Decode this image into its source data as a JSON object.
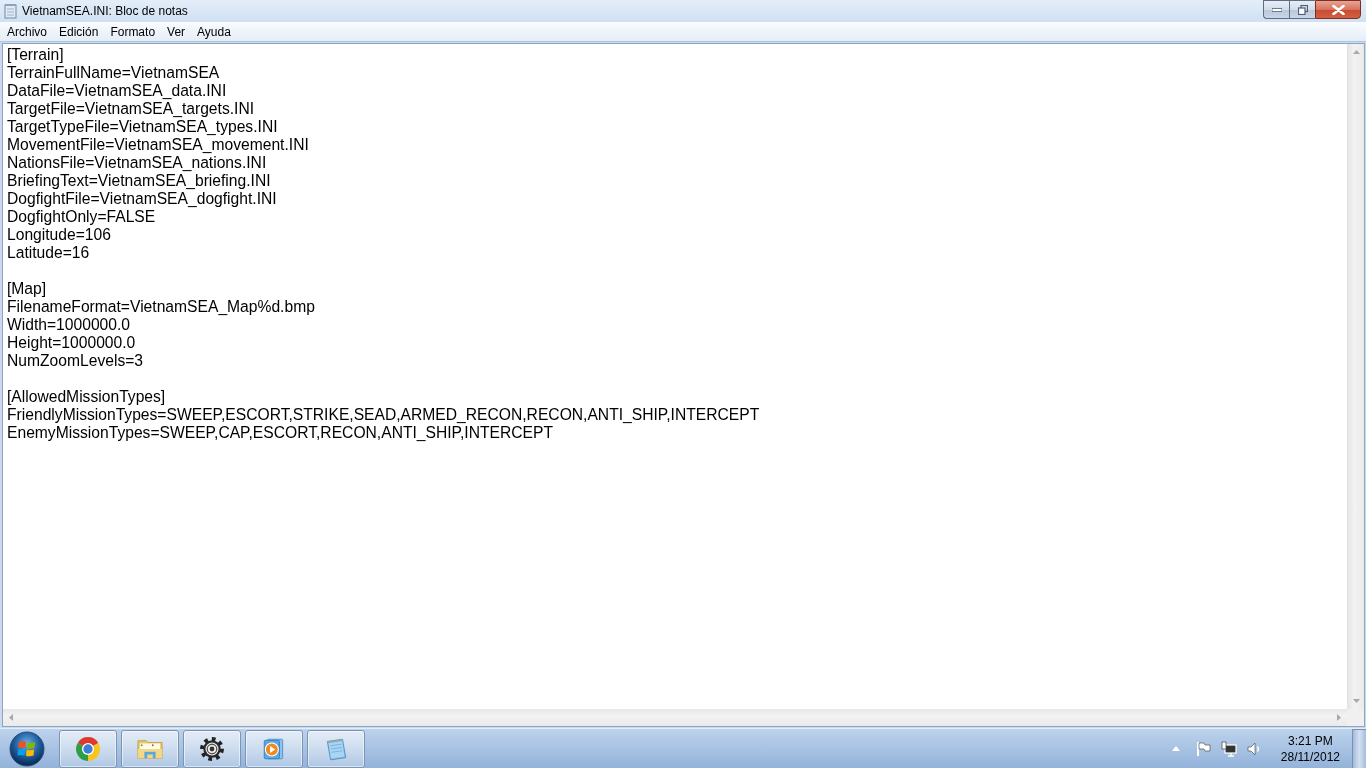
{
  "window": {
    "title": "VietnamSEA.INI: Bloc de notas"
  },
  "menu_bar": [
    "Archivo",
    "Edición",
    "Formato",
    "Ver",
    "Ayuda"
  ],
  "document": {
    "sections": [
      {
        "header": "[Terrain]",
        "lines": [
          "TerrainFullName=VietnamSEA",
          "DataFile=VietnamSEA_data.INI",
          "TargetFile=VietnamSEA_targets.INI",
          "TargetTypeFile=VietnamSEA_types.INI",
          "MovementFile=VietnamSEA_movement.INI",
          "NationsFile=VietnamSEA_nations.INI",
          "BriefingText=VietnamSEA_briefing.INI",
          "DogfightFile=VietnamSEA_dogfight.INI",
          "DogfightOnly=FALSE",
          "Longitude=106",
          "Latitude=16"
        ]
      },
      {
        "header": "[Map]",
        "lines": [
          "FilenameFormat=VietnamSEA_Map%d.bmp",
          "Width=1000000.0",
          "Height=1000000.0",
          "NumZoomLevels=3"
        ]
      },
      {
        "header": "[AllowedMissionTypes]",
        "lines": [
          "FriendlyMissionTypes=SWEEP,ESCORT,STRIKE,SEAD,ARMED_RECON,RECON,ANTI_SHIP,INTERCEPT",
          "EnemyMissionTypes=SWEEP,CAP,ESCORT,RECON,ANTI_SHIP,INTERCEPT"
        ]
      }
    ]
  },
  "taskbar": {
    "clock": {
      "time": "3:21 PM",
      "date": "28/11/2012"
    }
  }
}
